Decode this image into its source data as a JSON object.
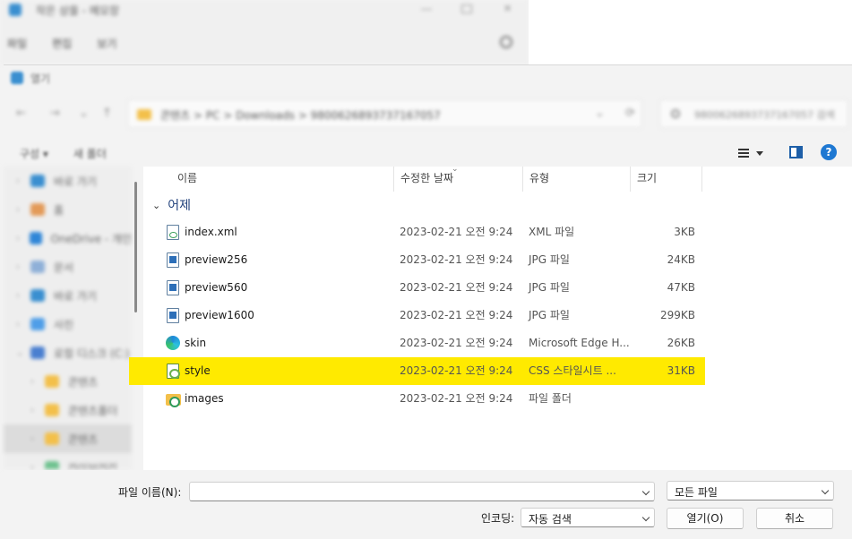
{
  "background_window": {
    "title": "작은 상을 - 메모장",
    "menu": [
      "파일",
      "편집",
      "보기"
    ]
  },
  "dialog": {
    "title": "열기",
    "address": {
      "breadcrumb": "콘텐츠 > PC > Downloads > 9800626893737167057"
    },
    "search": {
      "placeholder": "9800626893737167057 검색"
    },
    "toolbar": {
      "organize_label": "구성 ▾",
      "new_folder_label": "새 폴더"
    },
    "sidebar": {
      "items": [
        "바로 가기",
        "홈",
        "OneDrive - 개인",
        "문서",
        "바로 가기",
        "사진",
        "로컬 디스크 (C:)",
        "콘텐츠",
        "콘텐츠폴더",
        "콘텐츠",
        "라이브러리"
      ]
    },
    "columns": {
      "name": "이름",
      "date": "수정한 날짜",
      "type": "유형",
      "size": "크기"
    },
    "group_label": "어제",
    "files": [
      {
        "name": "index.xml",
        "date": "2023-02-21 오전 9:24",
        "type": "XML 파일",
        "size": "3KB",
        "icon": "xml-file-icon"
      },
      {
        "name": "preview256",
        "date": "2023-02-21 오전 9:24",
        "type": "JPG 파일",
        "size": "24KB",
        "icon": "image-file-icon"
      },
      {
        "name": "preview560",
        "date": "2023-02-21 오전 9:24",
        "type": "JPG 파일",
        "size": "47KB",
        "icon": "image-file-icon"
      },
      {
        "name": "preview1600",
        "date": "2023-02-21 오전 9:24",
        "type": "JPG 파일",
        "size": "299KB",
        "icon": "image-file-icon"
      },
      {
        "name": "skin",
        "date": "2023-02-21 오전 9:24",
        "type": "Microsoft Edge H...",
        "size": "26KB",
        "icon": "edge-html-icon"
      },
      {
        "name": "style",
        "date": "2023-02-21 오전 9:24",
        "type": "CSS 스타일시트 ...",
        "size": "31KB",
        "icon": "css-file-icon",
        "highlighted": true
      },
      {
        "name": "images",
        "date": "2023-02-21 오전 9:24",
        "type": "파일 폴더",
        "size": "",
        "icon": "folder-icon"
      }
    ],
    "highlight_color": "#ffea00",
    "filename": {
      "label": "파일 이름(N):",
      "value": ""
    },
    "filetype": {
      "value": "모든 파일"
    },
    "encoding": {
      "label": "인코딩:",
      "value": "자동 검색"
    },
    "open_label": "열기(O)",
    "cancel_label": "취소"
  }
}
